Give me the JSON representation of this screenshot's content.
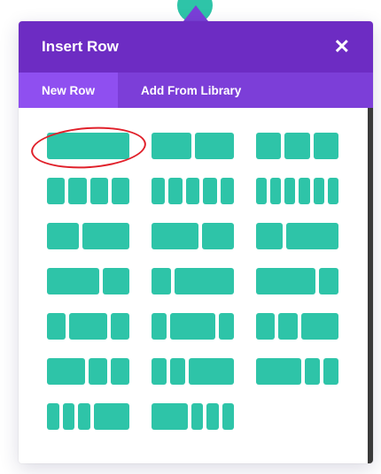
{
  "modal": {
    "title": "Insert Row",
    "close_icon": "close-icon",
    "tabs": [
      {
        "label": "New Row",
        "active": true
      },
      {
        "label": "Add From Library",
        "active": false
      }
    ]
  },
  "colors": {
    "header_bg": "#6d2cc3",
    "tabs_bg": "#7c3ed8",
    "active_tab_bg": "#8f4ff0",
    "column_block": "#2ec4a8",
    "annotation": "#e0202a"
  },
  "layouts": [
    {
      "name": "1",
      "cols": [
        1
      ]
    },
    {
      "name": "1-2 1-2",
      "cols": [
        1,
        1
      ]
    },
    {
      "name": "1-3 1-3 1-3",
      "cols": [
        1,
        1,
        1
      ]
    },
    {
      "name": "1-4 x4",
      "cols": [
        1,
        1,
        1,
        1
      ]
    },
    {
      "name": "1-5 x5",
      "cols": [
        1,
        1,
        1,
        1,
        1
      ]
    },
    {
      "name": "1-6 x6",
      "cols": [
        1,
        1,
        1,
        1,
        1,
        1
      ]
    },
    {
      "name": "2-5 3-5",
      "cols": [
        2,
        3
      ]
    },
    {
      "name": "3-5 2-5",
      "cols": [
        3,
        2
      ]
    },
    {
      "name": "1-3 2-3",
      "cols": [
        1,
        2
      ]
    },
    {
      "name": "2-3 1-3",
      "cols": [
        2,
        1
      ]
    },
    {
      "name": "1-4 3-4",
      "cols": [
        1,
        3
      ]
    },
    {
      "name": "3-4 1-4",
      "cols": [
        3,
        1
      ]
    },
    {
      "name": "1-4 1-2 1-4",
      "cols": [
        1,
        2,
        1
      ]
    },
    {
      "name": "1-5 3-5 1-5",
      "cols": [
        1,
        3,
        1
      ]
    },
    {
      "name": "1-4 1-4 1-2",
      "cols": [
        1,
        1,
        2
      ]
    },
    {
      "name": "1-2 1-4 1-4",
      "cols": [
        2,
        1,
        1
      ]
    },
    {
      "name": "1-5 1-5 3-5",
      "cols": [
        1,
        1,
        3
      ]
    },
    {
      "name": "3-5 1-5 1-5",
      "cols": [
        3,
        1,
        1
      ]
    },
    {
      "name": "1-6 1-6 1-6 1-2",
      "cols": [
        1,
        1,
        1,
        3
      ]
    },
    {
      "name": "1-2 1-6 1-6 1-6",
      "cols": [
        3,
        1,
        1,
        1
      ]
    }
  ],
  "highlighted_layout": 0
}
